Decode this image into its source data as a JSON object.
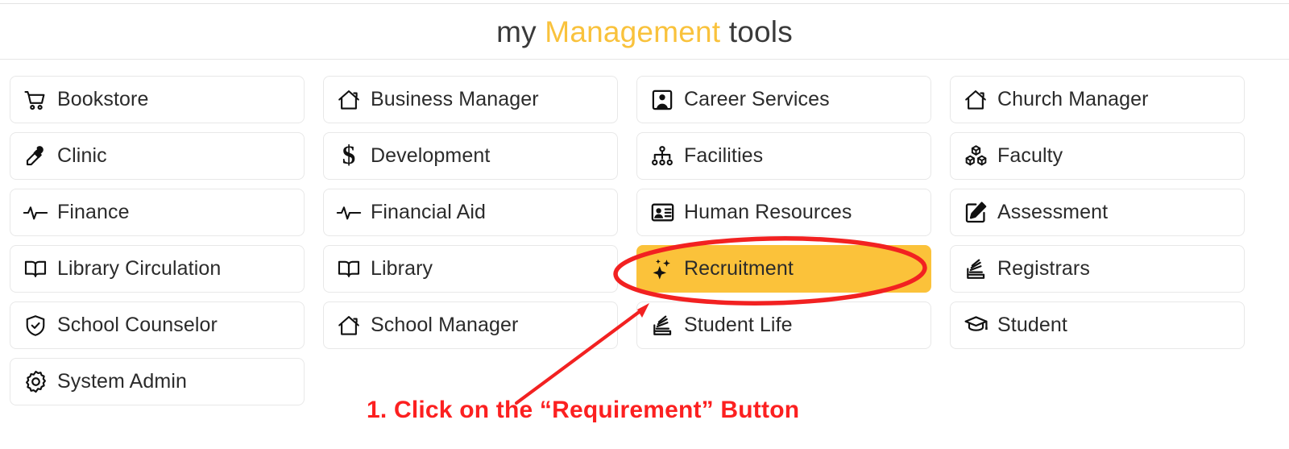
{
  "header": {
    "title_prefix": "my",
    "title_accent": "Management",
    "title_suffix": "tools"
  },
  "theme": {
    "accent_color": "#f9c23c",
    "highlight_color": "#fbc23a",
    "annotation_color": "#fc2020",
    "card_border_color": "#e8e8e8",
    "text_color": "#2b2b2b"
  },
  "grid": {
    "columns": [
      {
        "items": [
          {
            "label": "Bookstore",
            "icon": "shopping-cart-icon",
            "highlighted": false
          },
          {
            "label": "Clinic",
            "icon": "eyedropper-icon",
            "highlighted": false
          },
          {
            "label": "Finance",
            "icon": "pulse-activity-icon",
            "highlighted": false
          },
          {
            "label": "Library Circulation",
            "icon": "open-book-icon",
            "highlighted": false
          },
          {
            "label": "School Counselor",
            "icon": "shield-check-icon",
            "highlighted": false
          },
          {
            "label": "System Admin",
            "icon": "gear-icon",
            "highlighted": false
          }
        ]
      },
      {
        "items": [
          {
            "label": "Business Manager",
            "icon": "house-icon",
            "highlighted": false
          },
          {
            "label": "Development",
            "icon": "dollar-sign-icon",
            "highlighted": false
          },
          {
            "label": "Financial Aid",
            "icon": "pulse-activity-icon",
            "highlighted": false
          },
          {
            "label": "Library",
            "icon": "open-book-icon",
            "highlighted": false
          },
          {
            "label": "School Manager",
            "icon": "house-icon",
            "highlighted": false
          }
        ]
      },
      {
        "items": [
          {
            "label": "Career Services",
            "icon": "person-portrait-icon",
            "highlighted": false
          },
          {
            "label": "Facilities",
            "icon": "org-chart-icon",
            "highlighted": false
          },
          {
            "label": "Human Resources",
            "icon": "id-badge-icon",
            "highlighted": false
          },
          {
            "label": "Recruitment",
            "icon": "sparkles-icon",
            "highlighted": true
          },
          {
            "label": "Student Life",
            "icon": "stacked-books-icon",
            "highlighted": false
          }
        ]
      },
      {
        "items": [
          {
            "label": "Church Manager",
            "icon": "house-icon",
            "highlighted": false
          },
          {
            "label": "Faculty",
            "icon": "boxes-icon",
            "highlighted": false
          },
          {
            "label": "Assessment",
            "icon": "pencil-square-icon",
            "highlighted": false
          },
          {
            "label": "Registrars",
            "icon": "stacked-books-icon",
            "highlighted": false
          },
          {
            "label": "Student",
            "icon": "graduation-cap-icon",
            "highlighted": false
          }
        ]
      }
    ]
  },
  "annotation": {
    "step_text": "1. Click on the “Requirement” Button",
    "highlight_shape": "ellipse-around-recruitment",
    "arrow": "arrow-pointing-to-recruitment"
  }
}
